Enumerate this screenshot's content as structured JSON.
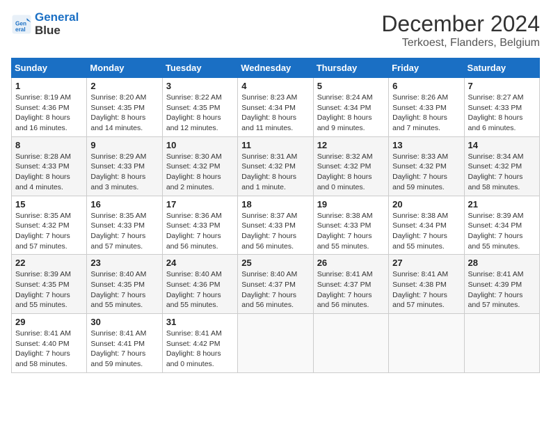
{
  "logo": {
    "line1": "General",
    "line2": "Blue"
  },
  "title": "December 2024",
  "location": "Terkoest, Flanders, Belgium",
  "days_header": [
    "Sunday",
    "Monday",
    "Tuesday",
    "Wednesday",
    "Thursday",
    "Friday",
    "Saturday"
  ],
  "weeks": [
    [
      {
        "day": "1",
        "sunrise": "8:19 AM",
        "sunset": "4:36 PM",
        "daylight": "8 hours and 16 minutes."
      },
      {
        "day": "2",
        "sunrise": "8:20 AM",
        "sunset": "4:35 PM",
        "daylight": "8 hours and 14 minutes."
      },
      {
        "day": "3",
        "sunrise": "8:22 AM",
        "sunset": "4:35 PM",
        "daylight": "8 hours and 12 minutes."
      },
      {
        "day": "4",
        "sunrise": "8:23 AM",
        "sunset": "4:34 PM",
        "daylight": "8 hours and 11 minutes."
      },
      {
        "day": "5",
        "sunrise": "8:24 AM",
        "sunset": "4:34 PM",
        "daylight": "8 hours and 9 minutes."
      },
      {
        "day": "6",
        "sunrise": "8:26 AM",
        "sunset": "4:33 PM",
        "daylight": "8 hours and 7 minutes."
      },
      {
        "day": "7",
        "sunrise": "8:27 AM",
        "sunset": "4:33 PM",
        "daylight": "8 hours and 6 minutes."
      }
    ],
    [
      {
        "day": "8",
        "sunrise": "8:28 AM",
        "sunset": "4:33 PM",
        "daylight": "8 hours and 4 minutes."
      },
      {
        "day": "9",
        "sunrise": "8:29 AM",
        "sunset": "4:33 PM",
        "daylight": "8 hours and 3 minutes."
      },
      {
        "day": "10",
        "sunrise": "8:30 AM",
        "sunset": "4:32 PM",
        "daylight": "8 hours and 2 minutes."
      },
      {
        "day": "11",
        "sunrise": "8:31 AM",
        "sunset": "4:32 PM",
        "daylight": "8 hours and 1 minute."
      },
      {
        "day": "12",
        "sunrise": "8:32 AM",
        "sunset": "4:32 PM",
        "daylight": "8 hours and 0 minutes."
      },
      {
        "day": "13",
        "sunrise": "8:33 AM",
        "sunset": "4:32 PM",
        "daylight": "7 hours and 59 minutes."
      },
      {
        "day": "14",
        "sunrise": "8:34 AM",
        "sunset": "4:32 PM",
        "daylight": "7 hours and 58 minutes."
      }
    ],
    [
      {
        "day": "15",
        "sunrise": "8:35 AM",
        "sunset": "4:32 PM",
        "daylight": "7 hours and 57 minutes."
      },
      {
        "day": "16",
        "sunrise": "8:35 AM",
        "sunset": "4:33 PM",
        "daylight": "7 hours and 57 minutes."
      },
      {
        "day": "17",
        "sunrise": "8:36 AM",
        "sunset": "4:33 PM",
        "daylight": "7 hours and 56 minutes."
      },
      {
        "day": "18",
        "sunrise": "8:37 AM",
        "sunset": "4:33 PM",
        "daylight": "7 hours and 56 minutes."
      },
      {
        "day": "19",
        "sunrise": "8:38 AM",
        "sunset": "4:33 PM",
        "daylight": "7 hours and 55 minutes."
      },
      {
        "day": "20",
        "sunrise": "8:38 AM",
        "sunset": "4:34 PM",
        "daylight": "7 hours and 55 minutes."
      },
      {
        "day": "21",
        "sunrise": "8:39 AM",
        "sunset": "4:34 PM",
        "daylight": "7 hours and 55 minutes."
      }
    ],
    [
      {
        "day": "22",
        "sunrise": "8:39 AM",
        "sunset": "4:35 PM",
        "daylight": "7 hours and 55 minutes."
      },
      {
        "day": "23",
        "sunrise": "8:40 AM",
        "sunset": "4:35 PM",
        "daylight": "7 hours and 55 minutes."
      },
      {
        "day": "24",
        "sunrise": "8:40 AM",
        "sunset": "4:36 PM",
        "daylight": "7 hours and 55 minutes."
      },
      {
        "day": "25",
        "sunrise": "8:40 AM",
        "sunset": "4:37 PM",
        "daylight": "7 hours and 56 minutes."
      },
      {
        "day": "26",
        "sunrise": "8:41 AM",
        "sunset": "4:37 PM",
        "daylight": "7 hours and 56 minutes."
      },
      {
        "day": "27",
        "sunrise": "8:41 AM",
        "sunset": "4:38 PM",
        "daylight": "7 hours and 57 minutes."
      },
      {
        "day": "28",
        "sunrise": "8:41 AM",
        "sunset": "4:39 PM",
        "daylight": "7 hours and 57 minutes."
      }
    ],
    [
      {
        "day": "29",
        "sunrise": "8:41 AM",
        "sunset": "4:40 PM",
        "daylight": "7 hours and 58 minutes."
      },
      {
        "day": "30",
        "sunrise": "8:41 AM",
        "sunset": "4:41 PM",
        "daylight": "7 hours and 59 minutes."
      },
      {
        "day": "31",
        "sunrise": "8:41 AM",
        "sunset": "4:42 PM",
        "daylight": "8 hours and 0 minutes."
      },
      null,
      null,
      null,
      null
    ]
  ]
}
